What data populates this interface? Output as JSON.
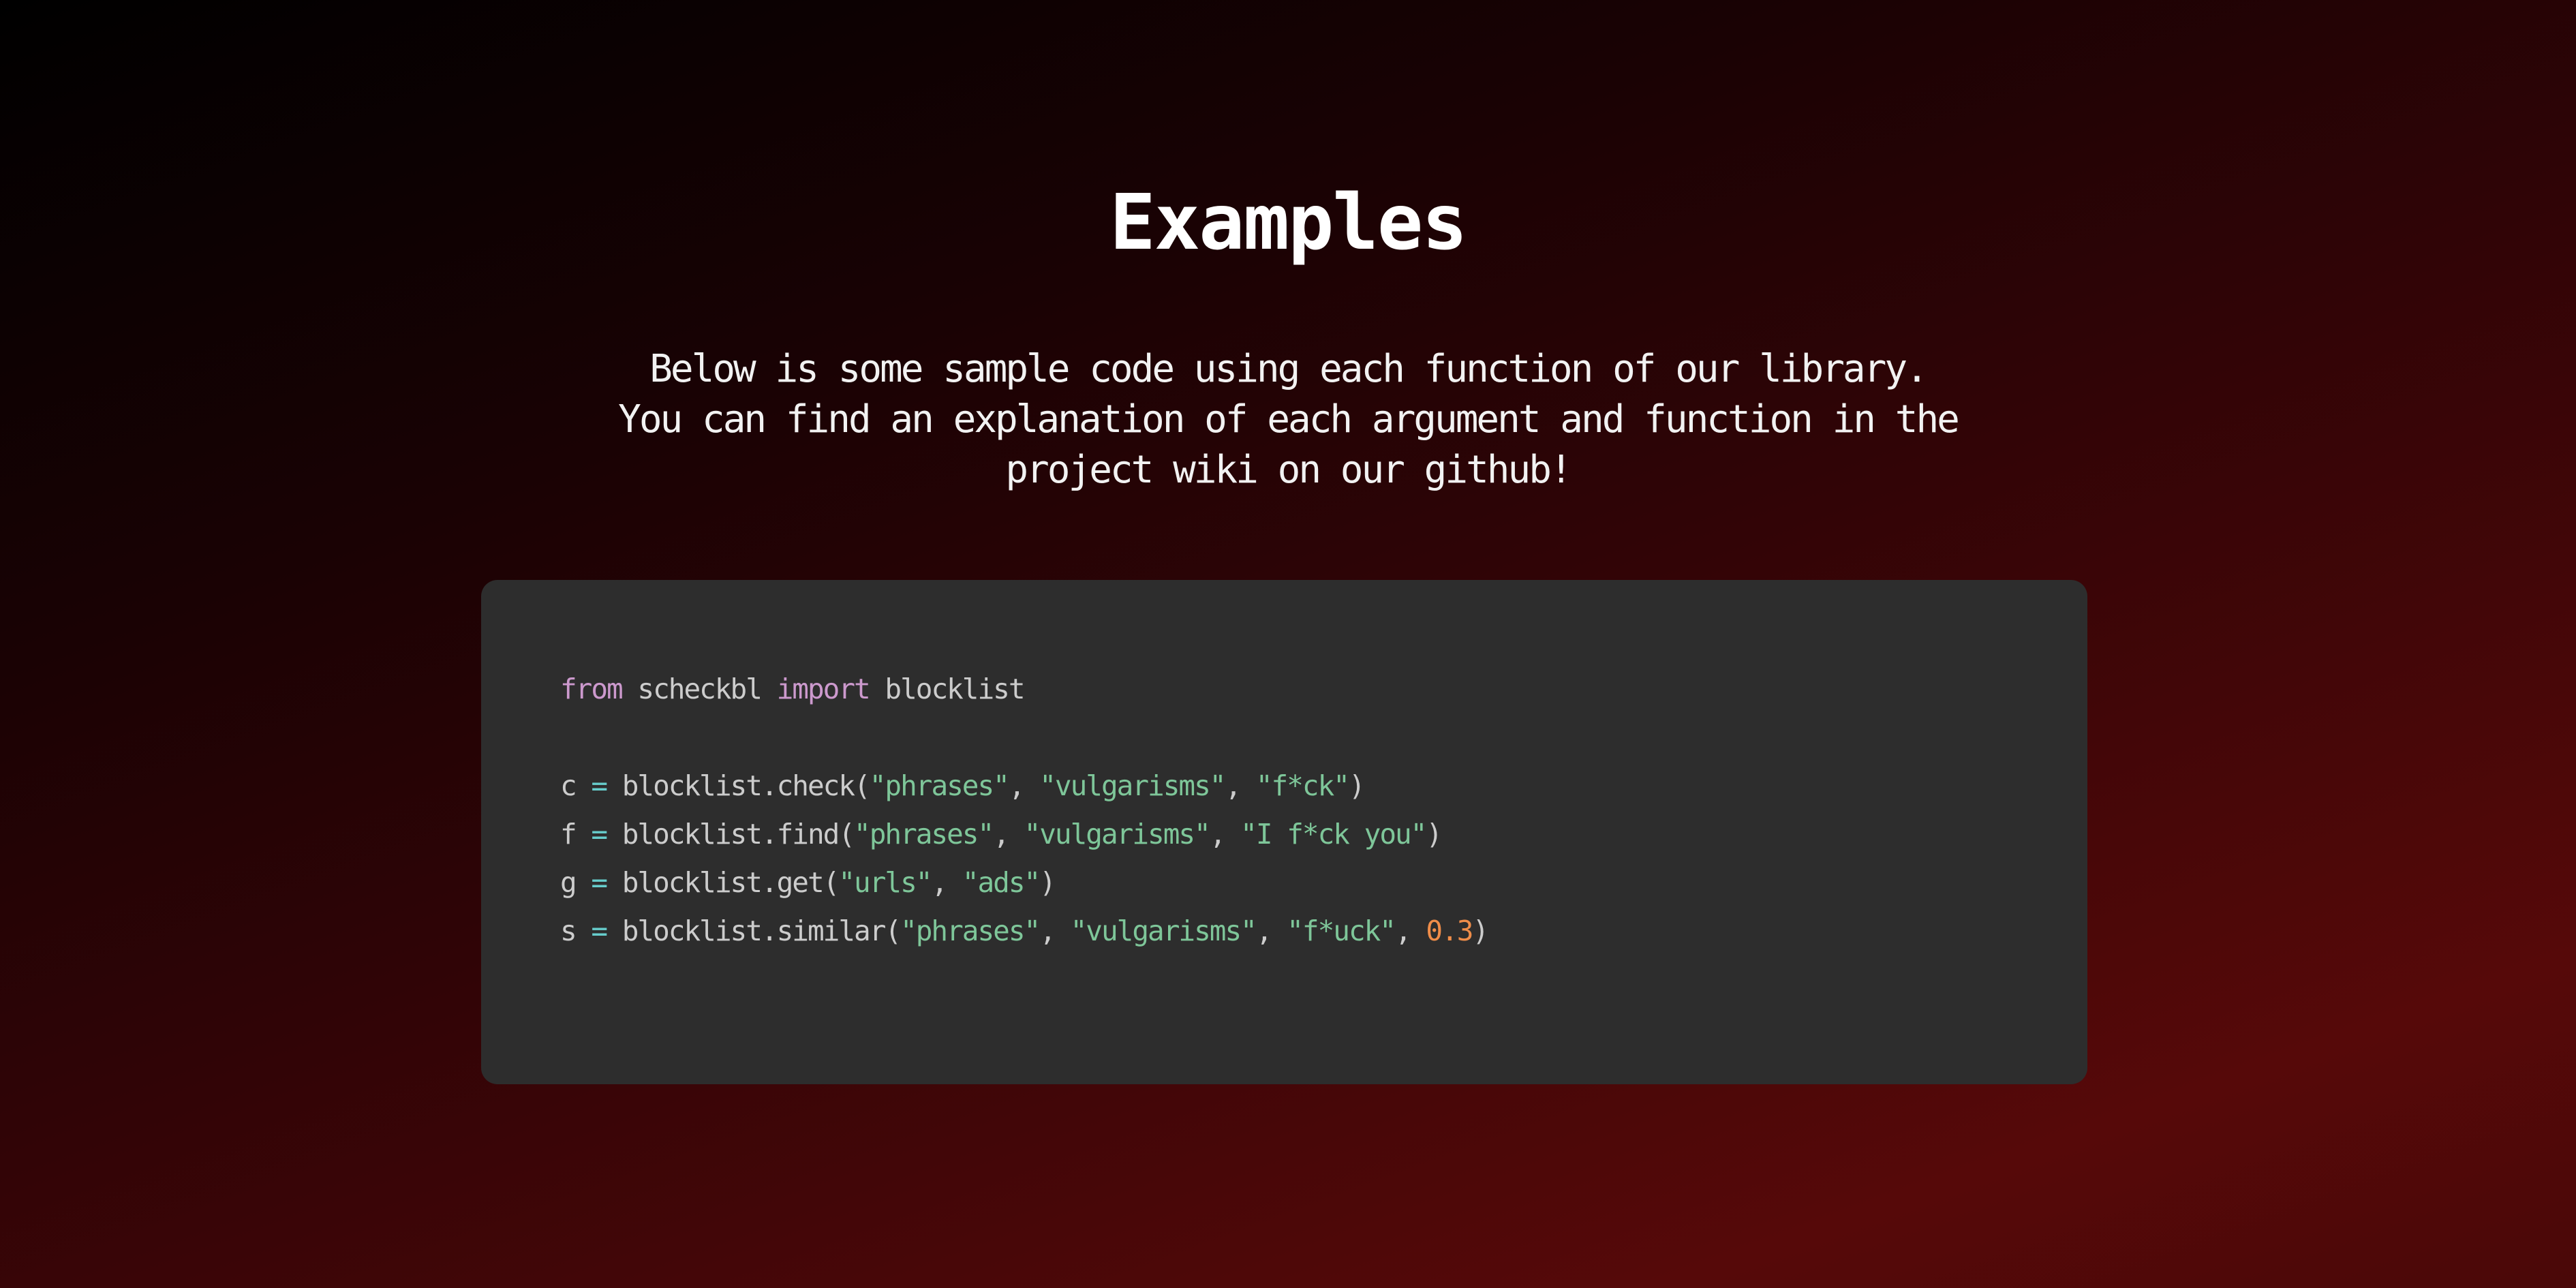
{
  "heading": "Examples",
  "description": [
    "Below is some sample code using each function of our library.",
    "You can find an explanation of each argument and function in the",
    "project wiki on our github!"
  ],
  "code_colors": {
    "background": "#2d2d2d",
    "keyword": "#cc99cd",
    "string": "#7ec699",
    "number": "#f08d49",
    "operator": "#67cdcc",
    "text": "#cccccc"
  },
  "code_lines": [
    [
      [
        "kw",
        "from"
      ],
      [
        "txt",
        " scheckbl "
      ],
      [
        "kw",
        "import"
      ],
      [
        "txt",
        " blocklist"
      ]
    ],
    [],
    [
      [
        "txt",
        "c "
      ],
      [
        "op",
        "="
      ],
      [
        "txt",
        " blocklist.check("
      ],
      [
        "str",
        "\"phrases\""
      ],
      [
        "txt",
        ", "
      ],
      [
        "str",
        "\"vulgarisms\""
      ],
      [
        "txt",
        ", "
      ],
      [
        "str",
        "\"f*ck\""
      ],
      [
        "txt",
        ")"
      ]
    ],
    [
      [
        "txt",
        "f "
      ],
      [
        "op",
        "="
      ],
      [
        "txt",
        " blocklist.find("
      ],
      [
        "str",
        "\"phrases\""
      ],
      [
        "txt",
        ", "
      ],
      [
        "str",
        "\"vulgarisms\""
      ],
      [
        "txt",
        ", "
      ],
      [
        "str",
        "\"I f*ck you\""
      ],
      [
        "txt",
        ")"
      ]
    ],
    [
      [
        "txt",
        "g "
      ],
      [
        "op",
        "="
      ],
      [
        "txt",
        " blocklist.get("
      ],
      [
        "str",
        "\"urls\""
      ],
      [
        "txt",
        ", "
      ],
      [
        "str",
        "\"ads\""
      ],
      [
        "txt",
        ")"
      ]
    ],
    [
      [
        "txt",
        "s "
      ],
      [
        "op",
        "="
      ],
      [
        "txt",
        " blocklist.similar("
      ],
      [
        "str",
        "\"phrases\""
      ],
      [
        "txt",
        ", "
      ],
      [
        "str",
        "\"vulgarisms\""
      ],
      [
        "txt",
        ", "
      ],
      [
        "str",
        "\"f*uck\""
      ],
      [
        "txt",
        ", "
      ],
      [
        "num",
        "0.3"
      ],
      [
        "txt",
        ")"
      ]
    ]
  ]
}
